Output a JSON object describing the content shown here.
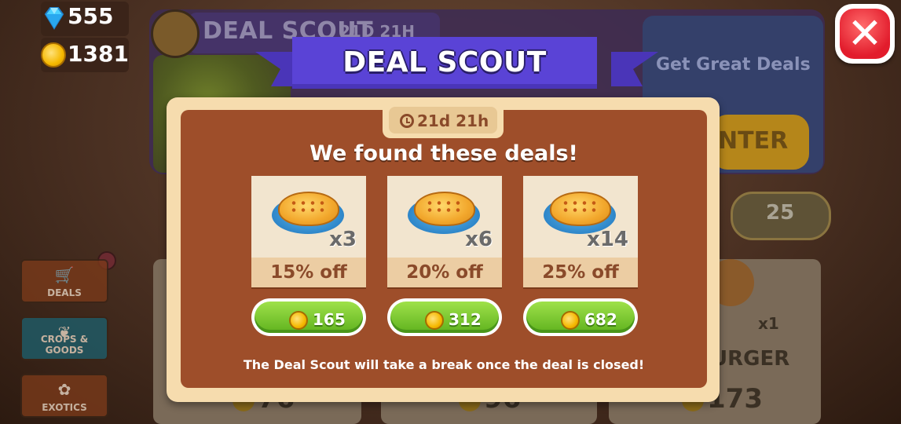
{
  "currency": {
    "gems": "555",
    "coins": "1381"
  },
  "background": {
    "panel_title": "DEAL SCOUT",
    "panel_timer": "21D 21H",
    "promo_text": "Get Great Deals",
    "enter_button": "NTER",
    "refresh_cost": "25",
    "burger_qty": "x1",
    "burger_name": "URGER",
    "card_prices": [
      "76",
      "96",
      "173"
    ]
  },
  "sidebar": {
    "items": [
      {
        "label": "DEALS",
        "icon": "cart-icon"
      },
      {
        "label": "CROPS & GOODS",
        "icon": "seed-icon"
      },
      {
        "label": "EXOTICS",
        "icon": "paw-icon"
      }
    ]
  },
  "modal": {
    "title": "DEAL SCOUT",
    "timer": "21d 21h",
    "headline": "We found these deals!",
    "deals": [
      {
        "qty": "x3",
        "discount": "15% off",
        "price": "165"
      },
      {
        "qty": "x6",
        "discount": "20% off",
        "price": "312"
      },
      {
        "qty": "x14",
        "discount": "25% off",
        "price": "682"
      }
    ],
    "footer": "The Deal Scout will take a break once the deal is closed!"
  },
  "colors": {
    "ribbon": "#5a43d6",
    "modal_border": "#f6dcae",
    "modal_body": "#9e4e2a",
    "buy_button": "#6cc424",
    "close_button": "#e21c2c"
  }
}
